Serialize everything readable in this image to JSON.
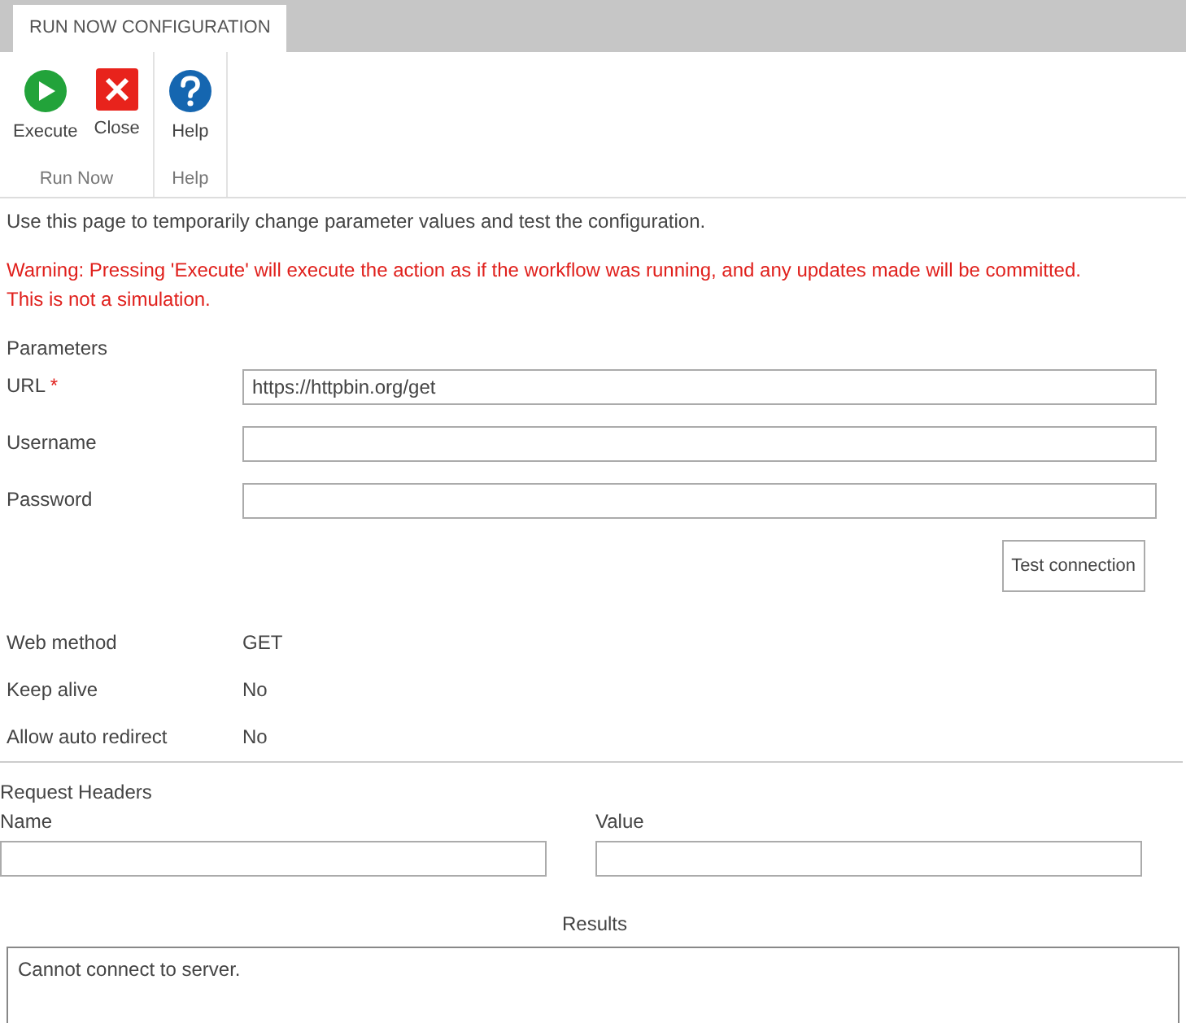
{
  "tab": {
    "label": "RUN NOW CONFIGURATION",
    "selected": true
  },
  "ribbon_groups": [
    {
      "label": "Run Now",
      "buttons": [
        {
          "kind": "execute",
          "label": "Execute"
        },
        {
          "kind": "close",
          "label": "Close"
        }
      ]
    },
    {
      "label": "Help",
      "buttons": [
        {
          "kind": "help",
          "label": "Help"
        }
      ]
    }
  ],
  "intro": "Use this page to temporarily change parameter values and test the configuration.",
  "warning": [
    "Warning: Pressing 'Execute' will execute the action as if the workflow was running, and any updates made will be committed.",
    "This is not a simulation."
  ],
  "parameters": {
    "heading": "Parameters",
    "required_mark": "*",
    "fields": [
      {
        "label": "URL",
        "required": true,
        "value": "https://httpbin.org/get"
      },
      {
        "label": "Username",
        "required": false
      },
      {
        "label": "Password",
        "required": false
      }
    ],
    "test_button": "Test connection",
    "settings": [
      {
        "label": "Web method",
        "value": "GET"
      },
      {
        "label": "Keep alive",
        "value": "No"
      },
      {
        "label": "Allow auto redirect",
        "value": "No"
      }
    ]
  },
  "request_headers": {
    "heading": "Request Headers",
    "columns": [
      "Name",
      "Value"
    ]
  },
  "results": {
    "heading": "Results",
    "text": "Cannot connect to server."
  }
}
